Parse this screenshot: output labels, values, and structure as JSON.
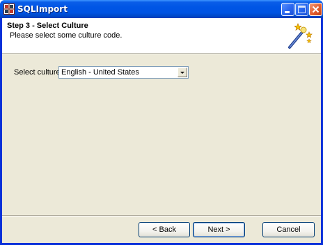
{
  "window": {
    "title": "SQLImport"
  },
  "header": {
    "step_title": "Step 3 - Select Culture",
    "step_description": "Please select some culture code."
  },
  "culture": {
    "label": "Select culture:",
    "selected": "English - United States"
  },
  "buttons": {
    "back": "< Back",
    "next": "Next >",
    "cancel": "Cancel"
  },
  "icons": {
    "app": "sqlimport-app-icon",
    "wizard": "magic-wand-icon"
  },
  "colors": {
    "titlebar": "#0054e3",
    "client_background": "#ece9d8",
    "header_background": "#ffffff",
    "close_button": "#e25d2f"
  }
}
